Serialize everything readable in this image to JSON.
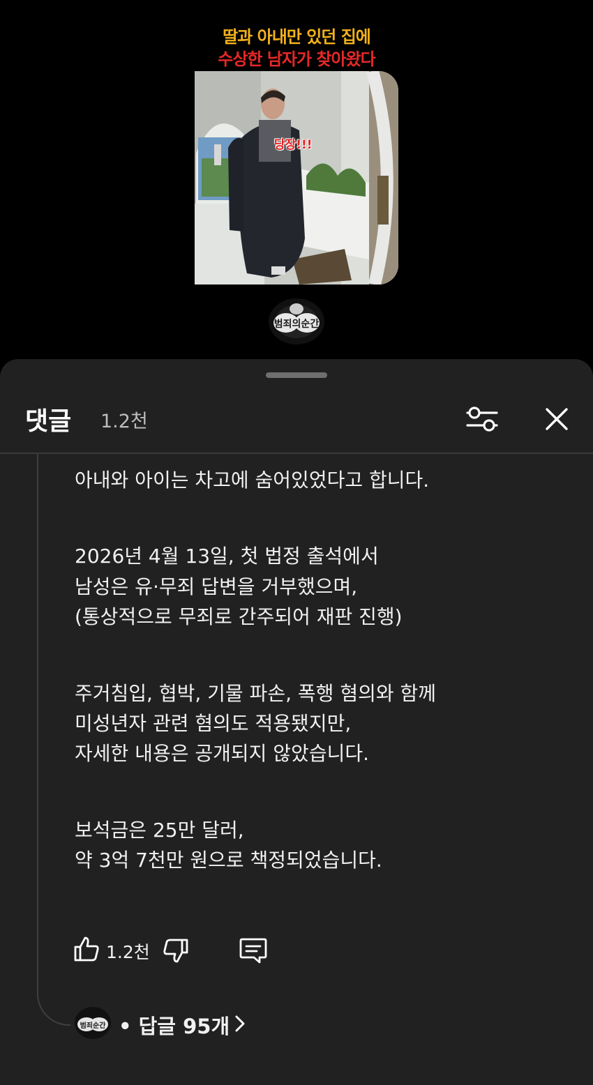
{
  "video": {
    "title_line1": "딸과 아내만 있던 집에",
    "title_line2": "수상한 남자가 찾아왔다",
    "thumbnail_caption": "당장!!!",
    "channel_logo_text": "범죄의 순간"
  },
  "comments_panel": {
    "title": "댓글",
    "count": "1.2천"
  },
  "comment": {
    "paragraphs": [
      [
        "아내와 아이는 차고에 숨어있었다고 합니다."
      ],
      [
        "2026년 4월 13일, 첫 법정 출석에서",
        "남성은 유·무죄 답변을 거부했으며,",
        "(통상적으로 무죄로 간주되어 재판 진행)"
      ],
      [
        "주거침입, 협박, 기물 파손, 폭행 혐의와 함께",
        "미성년자 관련 혐의도 적용됐지만,",
        "자세한 내용은 공개되지 않았습니다."
      ],
      [
        "보석금은 25만 달러,",
        "약 3억 7천만 원으로 책정되었습니다."
      ]
    ],
    "like_count": "1.2천",
    "replies_label": "• 답글 95개"
  },
  "colors": {
    "title_yellow": "#f3b21b",
    "title_red": "#e62828",
    "sheet_bg": "#212121",
    "text": "#f1f1f1"
  },
  "icons": [
    "filter-icon",
    "close-icon",
    "thumbs-up-icon",
    "thumbs-down-icon",
    "reply-icon",
    "chevron-right-icon"
  ]
}
